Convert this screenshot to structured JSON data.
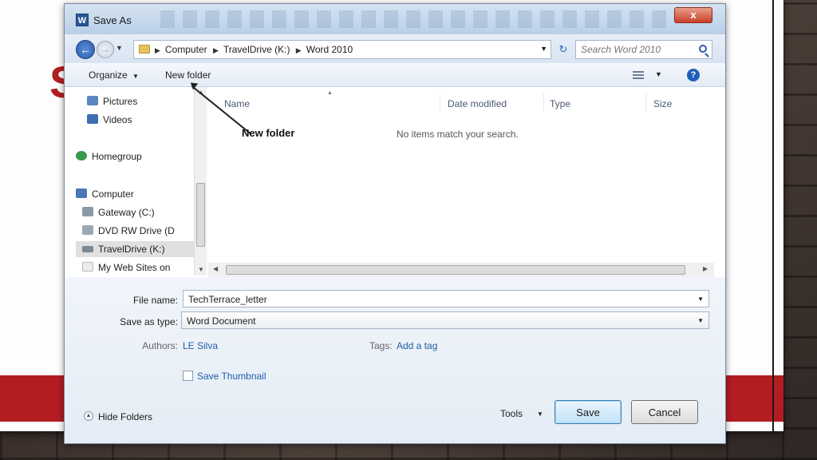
{
  "window": {
    "title": "Save As",
    "app_icon_letter": "W",
    "close_glyph": "x"
  },
  "slide": {
    "title_fragment": "S"
  },
  "address": {
    "crumbs": [
      "Computer",
      "TravelDrive (K:)",
      "Word 2010"
    ],
    "search_placeholder": "Search Word 2010"
  },
  "toolbar": {
    "organize_label": "Organize",
    "new_folder_label": "New folder"
  },
  "nav": {
    "items": [
      {
        "label": "Pictures",
        "icon": "pictures-icon",
        "color": "#5a86c4"
      },
      {
        "label": "Videos",
        "icon": "videos-icon",
        "color": "#3f6db3"
      },
      {
        "label": "Homegroup",
        "icon": "homegroup-icon",
        "color": "#3a9a4a"
      },
      {
        "label": "Computer",
        "icon": "computer-icon",
        "color": "#4b78b8"
      },
      {
        "label": "Gateway (C:)",
        "icon": "drive-icon",
        "color": "#8a9aa8"
      },
      {
        "label": "DVD RW Drive (D",
        "icon": "dvd-drive-icon",
        "color": "#9aa8b4"
      },
      {
        "label": "TravelDrive (K:)",
        "icon": "usb-drive-icon",
        "color": "#7c8894"
      },
      {
        "label": "My Web Sites on",
        "icon": "web-folder-icon",
        "color": "#d8d8d8"
      }
    ]
  },
  "filelist": {
    "columns": [
      "Name",
      "Date modified",
      "Type",
      "Size"
    ],
    "empty_message": "No items match your search."
  },
  "annotation": {
    "label": "New folder"
  },
  "form": {
    "file_name_label": "File name:",
    "file_name_value": "TechTerrace_letter",
    "save_type_label": "Save as type:",
    "save_type_value": "Word Document",
    "authors_label": "Authors:",
    "authors_value": "LE Silva",
    "tags_label": "Tags:",
    "tags_value": "Add a tag",
    "thumbnail_label": "Save Thumbnail"
  },
  "footer": {
    "hide_folders_label": "Hide Folders",
    "tools_label": "Tools",
    "save_label": "Save",
    "cancel_label": "Cancel"
  },
  "colors": {
    "accent_red": "#b31d21",
    "link_blue": "#1f5fa8"
  }
}
